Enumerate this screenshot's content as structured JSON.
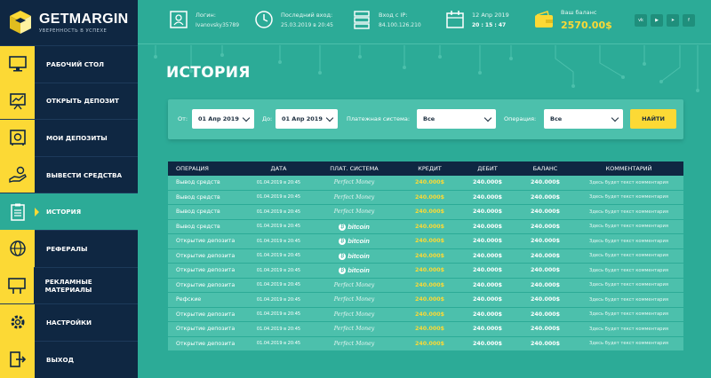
{
  "brand": {
    "name": "GETMARGIN",
    "tagline": "УВЕРЕННОСТЬ В УСПЕХЕ"
  },
  "topbar": {
    "login": {
      "label": "Логин:",
      "value": "Ivanovsky35789"
    },
    "last_login": {
      "label": "Последний вход:",
      "value": "25.03.2019 в 20:45"
    },
    "ip": {
      "label": "Вход с IP:",
      "value": "84.100.126.210"
    },
    "date": {
      "label": "12 Апр 2019",
      "value": "20 : 15 : 47"
    },
    "balance": {
      "label": "Ваш баланс",
      "value": "2570.00$"
    },
    "socials": [
      "vk",
      "yt",
      "tg",
      "fb"
    ]
  },
  "nav": [
    {
      "label": "РАБОЧИЙ СТОЛ",
      "icon": "monitor-icon"
    },
    {
      "label": "ОТКРЫТЬ ДЕПОЗИТ",
      "icon": "chart-board-icon"
    },
    {
      "label": "МОИ ДЕПОЗИТЫ",
      "icon": "safe-icon"
    },
    {
      "label": "ВЫВЕСТИ СРЕДСТВА",
      "icon": "hand-coins-icon"
    },
    {
      "label": "ИСТОРИЯ",
      "icon": "clipboard-icon",
      "active": true
    },
    {
      "label": "РЕФЕРАЛЫ",
      "icon": "globe-people-icon"
    },
    {
      "label": "РЕКЛАМНЫЕ МАТЕРИАЛЫ",
      "icon": "billboard-icon"
    },
    {
      "label": "НАСТРОЙКИ",
      "icon": "gear-icon"
    },
    {
      "label": "ВЫХОД",
      "icon": "exit-icon"
    }
  ],
  "page": {
    "title": "ИСТОРИЯ"
  },
  "filter": {
    "from_label": "От:",
    "from_value": "01 Апр 2019",
    "to_label": "До:",
    "to_value": "01 Апр 2019",
    "system_label": "Платежная система:",
    "system_value": "Все",
    "op_label": "Операция:",
    "op_value": "Все",
    "find": "НАЙТИ"
  },
  "table": {
    "headers": [
      "ОПЕРАЦИЯ",
      "ДАТА",
      "ПЛАТ. СИСТЕМА",
      "КРЕДИТ",
      "ДЕБИТ",
      "БАЛАНС",
      "КОММЕНТАРИЙ"
    ],
    "rows": [
      {
        "op": "Вывод средств",
        "date": "01.04.2019 в 20:45",
        "system": "Perfect Money",
        "kind": "pm",
        "credit": "240.000$",
        "debit": "240.000$",
        "balance": "240.000$",
        "comment": "Здесь будет текст комментария"
      },
      {
        "op": "Вывод средств",
        "date": "01.04.2019 в 20:45",
        "system": "Perfect Money",
        "kind": "pm",
        "credit": "240.000$",
        "debit": "240.000$",
        "balance": "240.000$",
        "comment": "Здесь будет текст комментария"
      },
      {
        "op": "Вывод средств",
        "date": "01.04.2019 в 20:45",
        "system": "Perfect Money",
        "kind": "pm",
        "credit": "240.000$",
        "debit": "240.000$",
        "balance": "240.000$",
        "comment": "Здесь будет текст комментария"
      },
      {
        "op": "Вывод средств",
        "date": "01.04.2019 в 20:45",
        "system": "bitcoin",
        "kind": "btc",
        "credit": "240.000$",
        "debit": "240.000$",
        "balance": "240.000$",
        "comment": "Здесь будет текст комментария"
      },
      {
        "op": "Открытие депозита",
        "date": "01.04.2019 в 20:45",
        "system": "bitcoin",
        "kind": "btc",
        "credit": "240.000$",
        "debit": "240.000$",
        "balance": "240.000$",
        "comment": "Здесь будет текст комментария"
      },
      {
        "op": "Открытие депозита",
        "date": "01.04.2019 в 20:45",
        "system": "bitcoin",
        "kind": "btc",
        "credit": "240.000$",
        "debit": "240.000$",
        "balance": "240.000$",
        "comment": "Здесь будет текст комментария"
      },
      {
        "op": "Открытие депозита",
        "date": "01.04.2019 в 20:45",
        "system": "bitcoin",
        "kind": "btc",
        "credit": "240.000$",
        "debit": "240.000$",
        "balance": "240.000$",
        "comment": "Здесь будет текст комментария"
      },
      {
        "op": "Открытие депозита",
        "date": "01.04.2019 в 20:45",
        "system": "Perfect Money",
        "kind": "pm",
        "credit": "240.000$",
        "debit": "240.000$",
        "balance": "240.000$",
        "comment": "Здесь будет текст комментария"
      },
      {
        "op": "Рефские",
        "date": "01.04.2019 в 20:45",
        "system": "Perfect Money",
        "kind": "pm",
        "credit": "240.000$",
        "debit": "240.000$",
        "balance": "240.000$",
        "comment": "Здесь будет текст комментария"
      },
      {
        "op": "Открытие депозита",
        "date": "01.04.2019 в 20:45",
        "system": "Perfect Money",
        "kind": "pm",
        "credit": "240.000$",
        "debit": "240.000$",
        "balance": "240.000$",
        "comment": "Здесь будет текст комментария"
      },
      {
        "op": "Открытие депозита",
        "date": "01.04.2019 в 20:45",
        "system": "Perfect Money",
        "kind": "pm",
        "credit": "240.000$",
        "debit": "240.000$",
        "balance": "240.000$",
        "comment": "Здесь будет текст комментария"
      },
      {
        "op": "Открытие депозита",
        "date": "01.04.2019 в 20:45",
        "system": "Perfect Money",
        "kind": "pm",
        "credit": "240.000$",
        "debit": "240.000$",
        "balance": "240.000$",
        "comment": "Здесь будет текст комментария"
      }
    ]
  },
  "colors": {
    "sidebar": "#0f2742",
    "accent": "#fcd935",
    "bg": "#2cab97",
    "panel": "#4cc0ac"
  }
}
